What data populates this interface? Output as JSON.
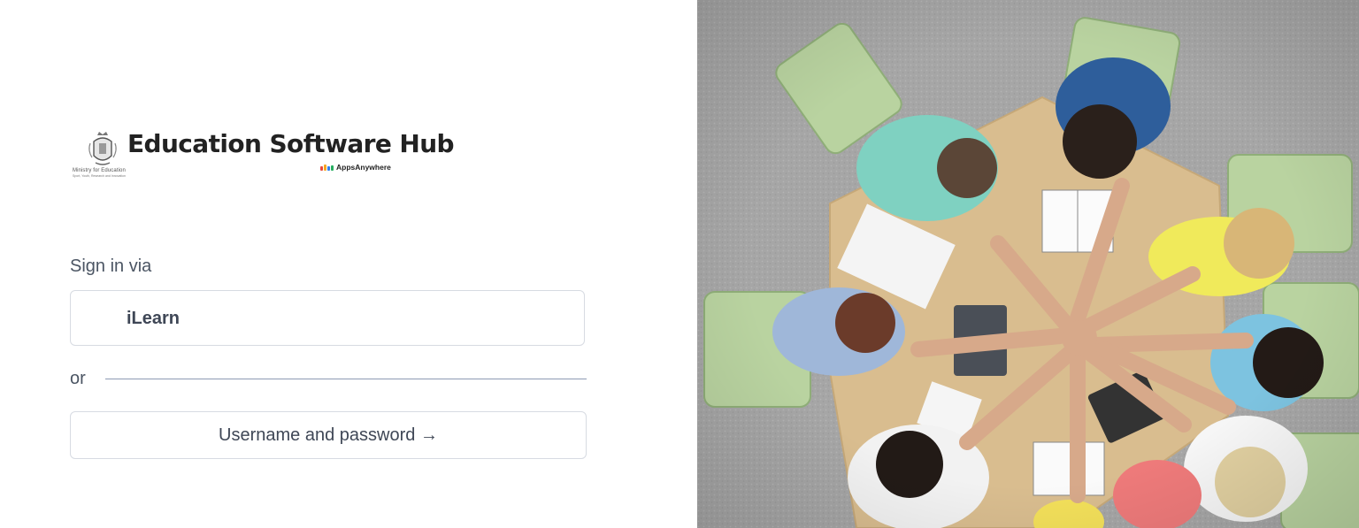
{
  "logo": {
    "title": "Education Software Hub",
    "ministry": "Ministry for Education",
    "ministry_sub": "Sport, Youth, Research and Innovation",
    "brand": "AppsAnywhere",
    "brand_colors": [
      "#e84a3c",
      "#f5a623",
      "#2f80ed",
      "#27ae60"
    ]
  },
  "signin": {
    "label": "Sign in via",
    "provider_label": "iLearn",
    "or_label": "or",
    "userpass_label": "Username and password →"
  },
  "hero": {
    "icon": "team-hands-photo"
  },
  "colors": {
    "text_muted": "#4b5563",
    "button_text": "#3f4756",
    "border": "#d7dbe2",
    "divider": "#8e9ab3"
  }
}
